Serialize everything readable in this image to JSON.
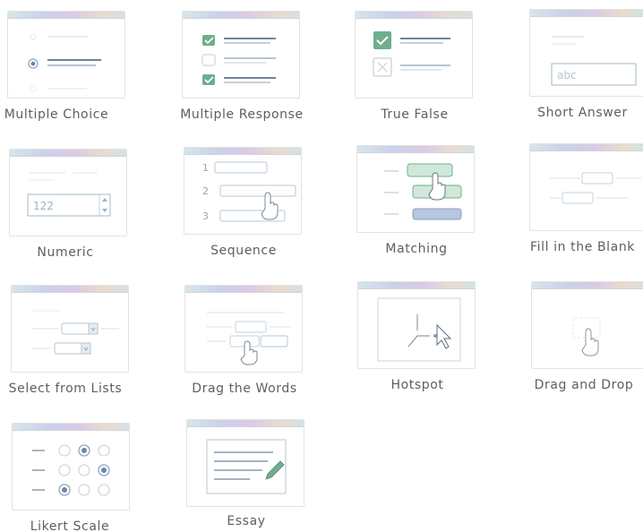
{
  "question_types": [
    {
      "label": "Multiple Choice",
      "icon": "multiple-choice-icon"
    },
    {
      "label": "Multiple Response",
      "icon": "multiple-response-icon"
    },
    {
      "label": "True False",
      "icon": "true-false-icon"
    },
    {
      "label": "Short Answer",
      "icon": "short-answer-icon"
    },
    {
      "label": "Numeric",
      "icon": "numeric-icon"
    },
    {
      "label": "Sequence",
      "icon": "sequence-icon"
    },
    {
      "label": "Matching",
      "icon": "matching-icon"
    },
    {
      "label": "Fill in the Blank",
      "icon": "fill-in-the-blank-icon"
    },
    {
      "label": "Select from Lists",
      "icon": "select-from-lists-icon"
    },
    {
      "label": "Drag the Words",
      "icon": "drag-the-words-icon"
    },
    {
      "label": "Hotspot",
      "icon": "hotspot-icon"
    },
    {
      "label": "Drag and Drop",
      "icon": "drag-and-drop-icon"
    },
    {
      "label": "Likert Scale",
      "icon": "likert-scale-icon"
    },
    {
      "label": "Essay",
      "icon": "essay-icon"
    }
  ],
  "icon_text": {
    "short_answer_value": "abc",
    "numeric_value": "122",
    "sequence_numbers": [
      "1",
      "2",
      "3"
    ]
  },
  "colors": {
    "accent_green": "#6fae8e",
    "line_blue": "#3f5a7a",
    "line_gray": "#c8ccd3",
    "field_border": "#9fb9c6"
  }
}
